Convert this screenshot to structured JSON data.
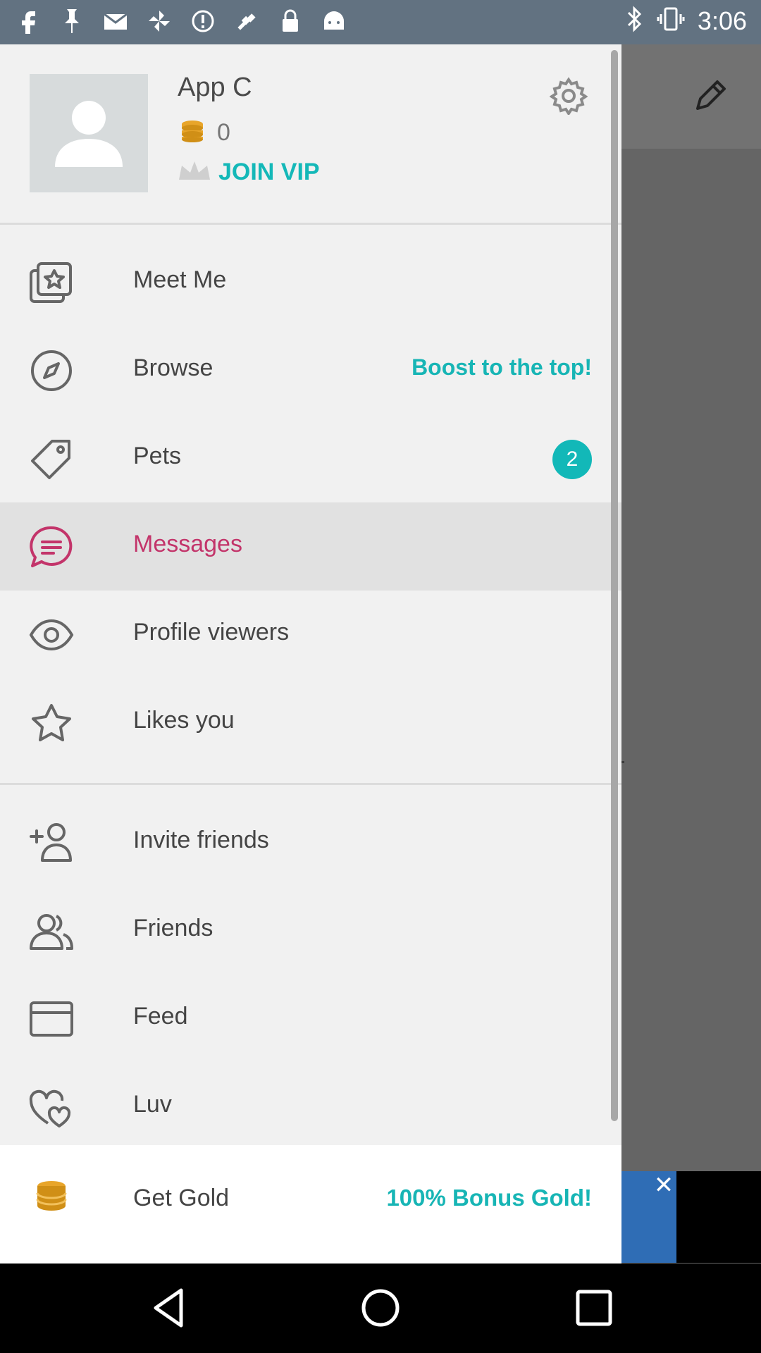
{
  "status_bar": {
    "time": "3:06",
    "left_icons": [
      "facebook-icon",
      "pin-icon",
      "mail-icon",
      "pinwheel-icon",
      "alert-icon",
      "fake-gps-icon",
      "lock-icon",
      "android-icon"
    ],
    "right_icons": [
      "bluetooth-icon",
      "vibrate-icon"
    ]
  },
  "profile": {
    "name": "App C",
    "coins": "0",
    "vip_label": "JOIN VIP"
  },
  "menu": {
    "items": [
      {
        "label": "Meet Me",
        "icon": "meet-me-icon"
      },
      {
        "label": "Browse",
        "icon": "compass-icon",
        "promo": "Boost to the top!"
      },
      {
        "label": "Pets",
        "icon": "tag-icon",
        "badge": "2"
      },
      {
        "label": "Messages",
        "icon": "chat-icon",
        "active": true
      },
      {
        "label": "Profile viewers",
        "icon": "eye-icon"
      },
      {
        "label": "Likes you",
        "icon": "star-icon"
      }
    ],
    "secondary": [
      {
        "label": "Invite friends",
        "icon": "add-person-icon"
      },
      {
        "label": "Friends",
        "icon": "people-icon"
      },
      {
        "label": "Feed",
        "icon": "feed-icon"
      },
      {
        "label": "Luv",
        "icon": "hearts-icon"
      }
    ]
  },
  "gold": {
    "label": "Get Gold",
    "bonus": "100% Bonus Gold!"
  },
  "colors": {
    "accent": "#14b8b8",
    "active": "#c3346a",
    "coin": "#e8a52a"
  }
}
